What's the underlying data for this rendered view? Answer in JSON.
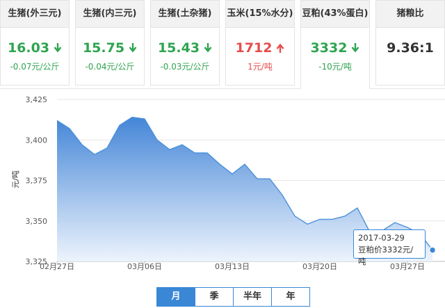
{
  "cards": [
    {
      "title": "生猪(外三元)",
      "value": "16.03",
      "change": "-0.07元/公斤",
      "direction": "down",
      "color": "#2ea44f"
    },
    {
      "title": "生猪(内三元)",
      "value": "15.75",
      "change": "-0.04元/公斤",
      "direction": "down",
      "color": "#2ea44f"
    },
    {
      "title": "生猪(土杂猪)",
      "value": "15.43",
      "change": "-0.03元/公斤",
      "direction": "down",
      "color": "#2ea44f"
    },
    {
      "title": "玉米(15%水分)",
      "value": "1712",
      "change": "1元/吨",
      "direction": "up",
      "color": "#e54d4d"
    },
    {
      "title": "豆粕(43%蛋白)",
      "value": "3332",
      "change": "-10元/吨",
      "direction": "down",
      "color": "#2ea44f"
    },
    {
      "title": "猪粮比",
      "value": "9.36:1",
      "change": "",
      "direction": "none",
      "color": "#333333"
    }
  ],
  "tabs": [
    "月",
    "季",
    "半年",
    "年"
  ],
  "tooltip": {
    "date": "2017-03-29",
    "text": "豆粕价3332元/吨"
  },
  "chart_data": {
    "type": "area",
    "ylabel": "元/吨",
    "ylim": [
      3325,
      3425
    ],
    "yticks": [
      "3,325",
      "3,350",
      "3,375",
      "3,400",
      "3,425"
    ],
    "xticks": [
      "02月27日",
      "03月06日",
      "03月13日",
      "03月20日",
      "03月27日"
    ],
    "x": [
      "02-27",
      "02-28",
      "03-01",
      "03-02",
      "03-03",
      "03-04",
      "03-05",
      "03-06",
      "03-07",
      "03-08",
      "03-09",
      "03-10",
      "03-11",
      "03-12",
      "03-13",
      "03-14",
      "03-15",
      "03-16",
      "03-17",
      "03-18",
      "03-19",
      "03-20",
      "03-21",
      "03-22",
      "03-23",
      "03-24",
      "03-25",
      "03-26",
      "03-27",
      "03-28",
      "03-29"
    ],
    "values": [
      3412,
      3407,
      3397,
      3391,
      3395,
      3409,
      3414,
      3413,
      3400,
      3394,
      3397,
      3392,
      3392,
      3385,
      3379,
      3385,
      3376,
      3376,
      3366,
      3353,
      3348,
      3351,
      3351,
      3353,
      3358,
      3343,
      3344,
      3349,
      3346,
      3342,
      3332
    ],
    "colors": {
      "line": "#4a90d9",
      "fill_top": "#3a7fd5",
      "fill_bottom": "#eaf2fc",
      "marker": "#3a87d6"
    }
  }
}
